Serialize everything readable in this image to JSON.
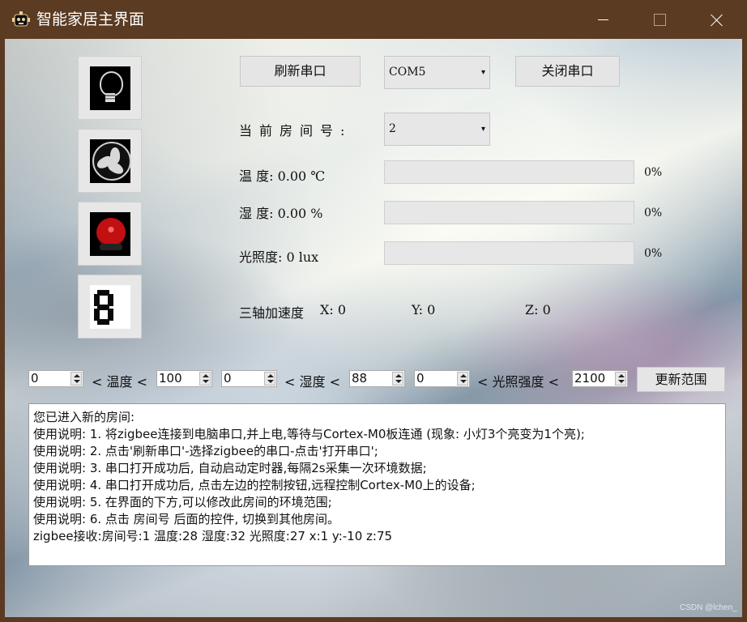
{
  "window": {
    "title": "智能家居主界面",
    "icons": {
      "app": "robot-icon",
      "minimize": "minimize-icon",
      "maximize": "maximize-icon",
      "close": "close-icon"
    }
  },
  "tools": [
    {
      "name": "bulb-button",
      "icon": "bulb-icon"
    },
    {
      "name": "fan-button",
      "icon": "fan-icon"
    },
    {
      "name": "alarm-button",
      "icon": "alarm-icon"
    },
    {
      "name": "digit-display-button",
      "icon": "seven-segment-digit-icon"
    }
  ],
  "serial": {
    "refresh_label": "刷新串口",
    "port_value": "COM5",
    "close_label": "关闭串口"
  },
  "room": {
    "label": "当前房间号:",
    "value": "2"
  },
  "sensors": {
    "temperature": {
      "label": "温  度: 0.00 ℃",
      "percent": "0%",
      "fill_percent": 0
    },
    "humidity": {
      "label": "湿  度: 0.00 %",
      "percent": "0%",
      "fill_percent": 0
    },
    "light": {
      "label": "光照度: 0 lux",
      "percent": "0%",
      "fill_percent": 0
    },
    "accel": {
      "label": "三轴加速度",
      "x": "X: 0",
      "y": "Y: 0",
      "z": "Z: 0"
    }
  },
  "ranges": {
    "temperature_min": "0",
    "temperature_label": "< 温度 <",
    "temperature_max": "100",
    "humidity_min": "0",
    "humidity_label": "< 湿度 <",
    "humidity_max": "88",
    "light_min": "0",
    "light_label": "< 光照强度 <",
    "light_max": "2100",
    "update_label": "更新范围"
  },
  "log": {
    "lines": [
      "您已进入新的房间:",
      "使用说明: 1. 将zigbee连接到电脑串口,并上电,等待与Cortex-M0板连通 (现象: 小灯3个亮变为1个亮);",
      "使用说明: 2. 点击'刷新串口'-选择zigbee的串口-点击'打开串口';",
      "使用说明: 3. 串口打开成功后, 自动启动定时器,每隔2s采集一次环境数据;",
      "使用说明: 4. 串口打开成功后, 点击左边的控制按钮,远程控制Cortex-M0上的设备;",
      "使用说明: 5. 在界面的下方,可以修改此房间的环境范围;",
      "使用说明: 6. 点击 房间号 后面的控件, 切换到其他房间。",
      "zigbee接收:房间号:1 温度:28 湿度:32 光照度:27 x:1 y:-10 z:75"
    ]
  },
  "watermark": "CSDN @lchen_"
}
